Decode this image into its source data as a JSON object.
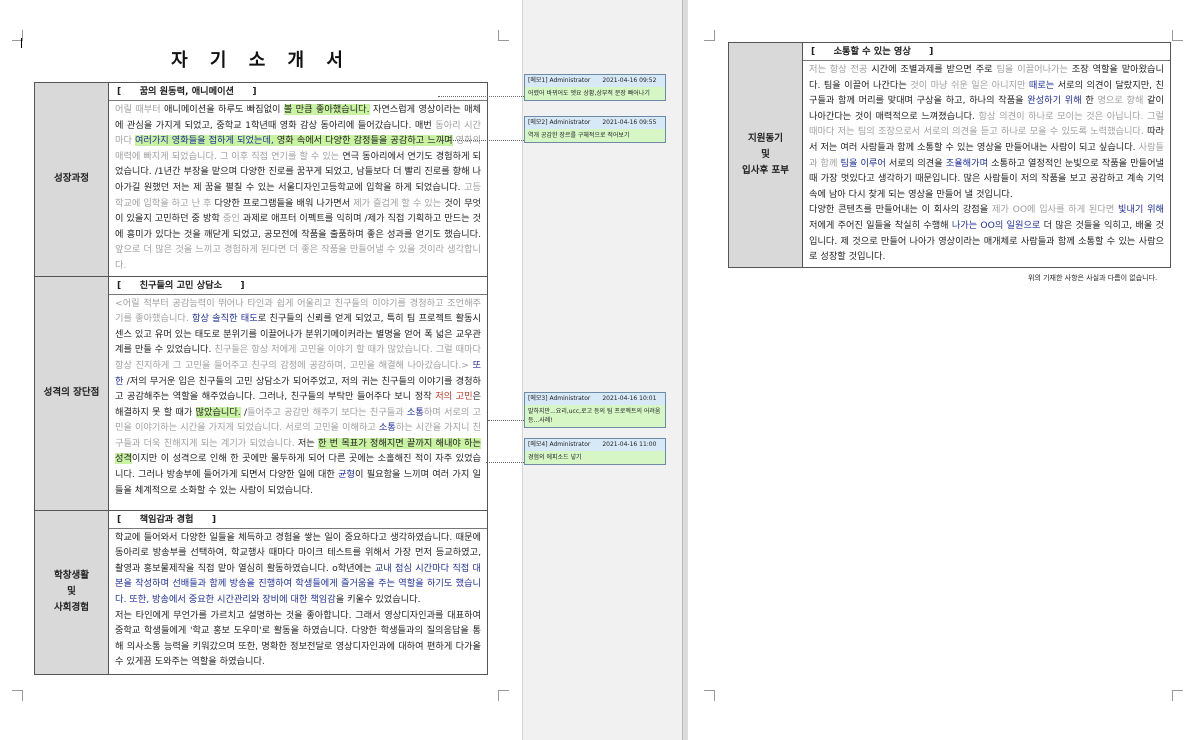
{
  "document": {
    "title": "자 기 소 개 서",
    "sections": [
      {
        "label": "성장과정",
        "heading": "[　　꿈의 원동력, 애니메이션　　]",
        "runs": [
          {
            "t": "어릴 때부터 ",
            "c": "g"
          },
          {
            "t": "애니메이션을 하루도 빠짐없이 "
          },
          {
            "t": "볼 만큼 좋아했습니다.",
            "h": 1
          },
          {
            "t": " 자연스럽게 영상이라는 매체에 관심을 가지게 되었고, 중학교 1학년때 영화 감상 동아리에 들어갔습니다. 매번 "
          },
          {
            "t": "동아리 시간마다 ",
            "c": "g"
          },
          {
            "t": "여러가지 영화들을 접하게 되었는데, ",
            "c": "b",
            "h": 1
          },
          {
            "t": "영화 속에서 다양한 감정들을 공감하고 느끼며",
            "h": 1
          },
          {
            "t": " 영화의 매력에 빠지게 되었습니다. 그 이후 직접 연기를 할 수 있는 ",
            "c": "g"
          },
          {
            "t": "연극 동아리에서 연기도 경험하게 되었습니다. /1년간 부장을 맡으며 다양한 진로를 꿈꾸게 되었고, 남들보다 더 빨리 진로를 향해 나아가길 원했던 저는 제 꿈을 펼칠 수 있는 서울디자인고등학교에 입학을 하게 되었습니다. "
          },
          {
            "t": "고등학교에 입학을 하고 난 후 ",
            "c": "g"
          },
          {
            "t": "다양한 프로그램들을 배워 나가면서 "
          },
          {
            "t": "제가 즐겁게 할 수 있는 ",
            "c": "g"
          },
          {
            "t": "것이 무엇이 있을지 고민하던 중 방학 "
          },
          {
            "t": "중인 ",
            "c": "g"
          },
          {
            "t": "과제로 애프터 이펙트를 익히며 /제가 직접 기획하고 만드는 것에 흥미가 있다는 것을 깨닫게 되었고, 공모전에 작품을 출품하며 좋은 성과를 얻기도 했습니다. "
          },
          {
            "t": "앞으로 더 많은 것을 느끼고 경험하게 된다면 더 좋은 작품을 만들어낼 수 있을 것이라 생각합니다.",
            "c": "g"
          }
        ]
      },
      {
        "label": "성격의 장단점",
        "heading": "[　　친구들의 고민 상담소　　]",
        "runs": [
          {
            "t": "<어릴 적부터 공감능력이 뛰어나 타인과 쉽게 어울리고 친구들의 이야기를 경청하고 조언해주기를 좋아했습니다. ",
            "c": "g"
          },
          {
            "t": "항상 솔직한 태도",
            "c": "b"
          },
          {
            "t": "로 친구들의 신뢰를 얻게 되었고, 특히 팀 프로젝트 활동시 센스 있고 유머 있는 태도로 분위기를 이끌어나가 분위기메이커라는 별명을 얻어 폭 넓은 교우관계를 만들 수 있었습니다. "
          },
          {
            "t": "친구들은 항상 저에게 고민을 이야기 할 때가 많았습니다. 그럴 때마다 항상 진지하게 그 고민을 들어주고 친구의 감정에 공감하며, 고민을 해결해 나아갔습니다.> ",
            "c": "g"
          },
          {
            "t": "또한",
            "c": "b"
          },
          {
            "t": " /저의 무거운 입은 친구들의 고민 상담소가 되어주었고, 저의 귀는 친구들의 이야기를 경청하고 공감해주는 역할을 해주었습니다. 그러나, 친구들의 부탁만 들어주다 보니 정작 "
          },
          {
            "t": "저의 고민",
            "c": "r"
          },
          {
            "t": "은 해결하지 못 할 때가 "
          },
          {
            "t": "많았습니다.",
            "h": 1
          },
          {
            "t": " /"
          },
          {
            "t": "들어주고 공감만 해주기 보다는 친구들과 ",
            "c": "g"
          },
          {
            "t": "소통",
            "c": "b"
          },
          {
            "t": "하며 서로의 고민을 이야기하는 시간을 가지게 되었습니다. 서로의 고민을 이해하고 ",
            "c": "g"
          },
          {
            "t": "소통",
            "c": "b"
          },
          {
            "t": "하는 시간을 가지니 친구들과 더욱 친해지게 되는 계기가 되었습니다. ",
            "c": "g"
          },
          {
            "t": "저는 "
          },
          {
            "t": "한 번 목표가 정해지면 끝까지 해내야 하는 성격",
            "h": 1
          },
          {
            "t": "이지만 이 성격으로 인해 한 곳에만 몰두하게 되어 다른 곳에는 소홀해진 적이 자주 있었습니다. 그러나 방송부에 들어가게 되면서 다양한 일에 대한 "
          },
          {
            "t": "균형",
            "c": "b"
          },
          {
            "t": "이 필요함을 느끼며 여러 가지 일들을 체계적으로 소화할 수 있는 사람이 되었습니다."
          }
        ]
      },
      {
        "label": "학창생활\n및\n사회경험",
        "heading": "[　　책임감과 경험　　]",
        "runs": [
          {
            "t": " 학교에 들어와서 다양한 일들을 체득하고 경험을 쌓는 일이 중요하다고 생각하였습니다. 때문에 동아리로 방송부를 선택하여, 학교행사 때마다 마이크 테스트를 위해서 가장 먼저 등교하였고, 촬영과 홍보물제작을 직접 맡아 열심히 활동하였습니다. o학년에는 "
          },
          {
            "t": "교내 점심 시간마다 직접 대본을 작성하며 선배들과 함께 방송을 진행하여 학생들에게 즐거움을 주는 역할을 하기도 했습니다. 또한, 방송에서 중요한 시간관리와 장비에 대한 책임감",
            "c": "b"
          },
          {
            "t": "을 키울수 있었습니다.\n 저는 타인에게 무언가를 가르치고 설명하는 것을 좋아합니다. 그래서 영상디자인과를 대표하여 중학교 학생들에게 '학교 홍보 도우미'로 활동을 하였습니다. 다양한 학생들과의 질의응답을 통해 의사소통 능력을 키워갔으며 또한, 명확한 정보전달로 영상디자인과에 대하여 편하게 다가올 수 있게끔 도와주는 역할을 하였습니다."
          }
        ]
      },
      {
        "label": "지원동기\n및\n입사후 포부",
        "heading": "[　　소통할 수 있는 영상　　]",
        "runs": [
          {
            "t": "저는 항상 전공 ",
            "c": "g"
          },
          {
            "t": "시간에 조별과제를 받으면 주로 "
          },
          {
            "t": "팀을 이끌어나가는 ",
            "c": "g"
          },
          {
            "t": "조장 역할을 맡아왔습니다. 팀을 이끌어 나간다는 "
          },
          {
            "t": "것이 마냥 쉬운 일은 아니지만 ",
            "c": "g"
          },
          {
            "t": "때로는",
            "c": "b"
          },
          {
            "t": " 서로의 의견이 달랐지만, 친구들과 함께 머리를 맞대며 구상을 하고, 하나의 작품을 "
          },
          {
            "t": "완성하기 위해",
            "c": "b"
          },
          {
            "t": " 한 "
          },
          {
            "t": "명으로 향해 ",
            "c": "g"
          },
          {
            "t": "같이 나아간다는 것이 매력적으로 느껴졌습니다. "
          },
          {
            "t": "항상 의견이 하나로 모이는 것은 아닙니다. 그럴 때마다 저는 팀의 조장으로서 서로의 의견을 듣고 하나로 모을 수 있도록 노력했습니다. ",
            "c": "g"
          },
          {
            "t": "따라서 저는 여러 사람들과 함께 소통할 수 있는 영상을 만들어내는 사람이 되고 싶습니다. "
          },
          {
            "t": "사람들과 함께 ",
            "c": "g"
          },
          {
            "t": "팀을 이루어",
            "c": "b"
          },
          {
            "t": " 서로의 의견을 "
          },
          {
            "t": "조율해가며",
            "c": "b"
          },
          {
            "t": " 소통하고 열정적인 눈빛으로 작품을 만들어낼 때 가장 멋있다고 생각하기 때문입니다. 많은 사람들이 저의 작품을 보고 공감하고 계속 기억 속에 남아 다시 찾게 되는 영상을 만들어 낼 것입니다.\n다양한 콘텐츠를 만들어내는 이 회사의 강점을 "
          },
          {
            "t": "제가 OO에 입사를 하게 된다면 ",
            "c": "g"
          },
          {
            "t": "빛내기 위해",
            "c": "b"
          },
          {
            "t": " 저에게 주어진 일들을 착실히 수행해 "
          },
          {
            "t": "나가는 OO의 일원으로",
            "c": "b"
          },
          {
            "t": " 더 많은 것들을 익히고, 배울 것입니다. 제 것으로 만들어 나아가 영상이라는 매개체로 사람들과 함께 소통할 수 있는 사람으로 성장할 것입니다."
          }
        ]
      }
    ],
    "footnote": "위의 기재한 사항은 사실과 다름이 없습니다."
  },
  "comments": [
    {
      "header": "[메모1] Administrator　　2021-04-16 09:52",
      "body": "어렸어 바뀌어도 엣요 상황,상부적 문장 빠어나기"
    },
    {
      "header": "[메모2] Administrator　　2021-04-16 09:55",
      "body": "역개 공감한 장르를 구체적으로 적어보기"
    },
    {
      "header": "[메모3] Administrator　　2021-04-16 10:01",
      "body": "말하지만...요리,ucc,로고 등의 팀 프로젝트의 어려움 등...사례!"
    },
    {
      "header": "[메모4] Administrator　　2021-04-16 11:00",
      "body": "경험의 에피소드 넣기"
    }
  ]
}
